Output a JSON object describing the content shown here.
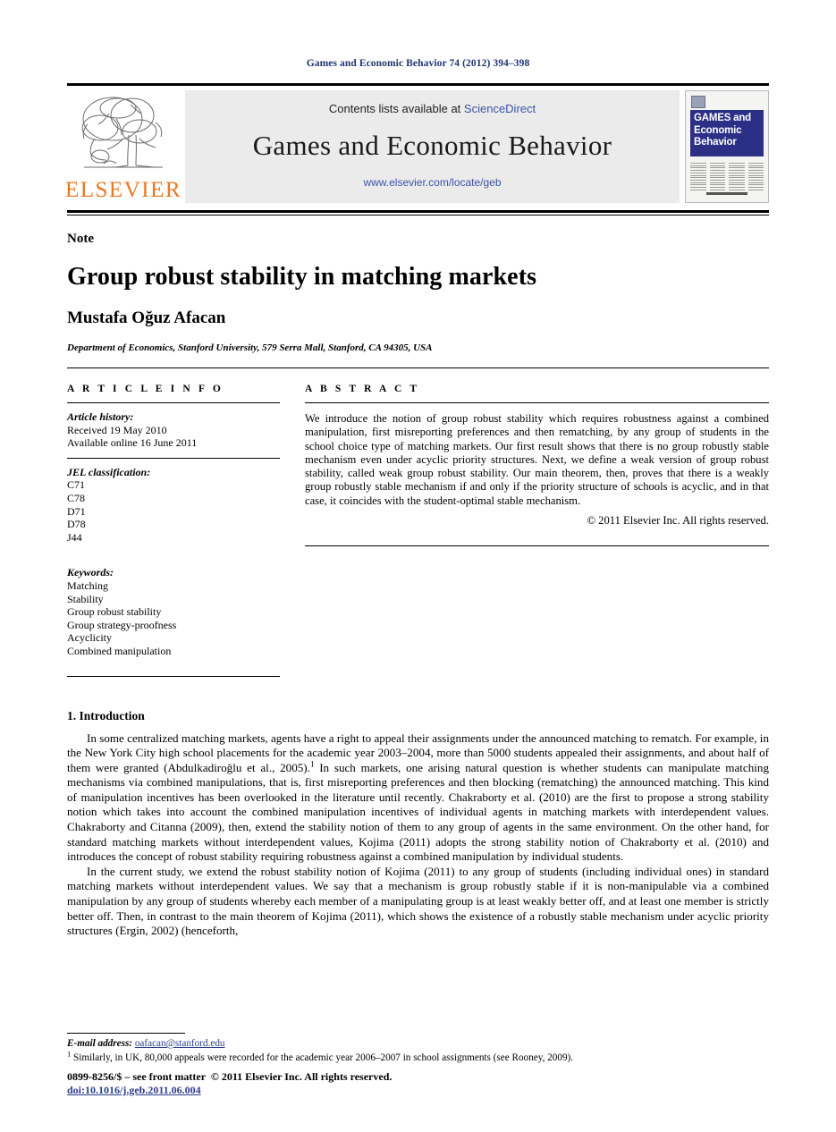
{
  "running_head": "Games and Economic Behavior 74 (2012) 394–398",
  "masthead": {
    "publisher_name": "ELSEVIER",
    "contents_prefix": "Contents lists available at",
    "sciencedirect": "ScienceDirect",
    "journal_name": "Games and Economic Behavior",
    "journal_url": "www.elsevier.com/locate/geb",
    "cover_title_line1": "GAMES and",
    "cover_title_line2": "Economic",
    "cover_title_line3": "Behavior"
  },
  "article": {
    "type_label": "Note",
    "title": "Group robust stability in matching markets",
    "author": "Mustafa Oğuz Afacan",
    "affiliation": "Department of Economics, Stanford University, 579 Serra Mall, Stanford, CA 94305, USA"
  },
  "article_info": {
    "heading": "A R T I C L E   I N F O",
    "history_label": "Article history:",
    "received": "Received 19 May 2010",
    "available_online": "Available online 16 June 2011",
    "jel_label": "JEL classification:",
    "jel_codes": [
      "C71",
      "C78",
      "D71",
      "D78",
      "J44"
    ],
    "keywords_label": "Keywords:",
    "keywords": [
      "Matching",
      "Stability",
      "Group robust stability",
      "Group strategy-proofness",
      "Acyclicity",
      "Combined manipulation"
    ]
  },
  "abstract": {
    "heading": "A B S T R A C T",
    "text": "We introduce the notion of group robust stability which requires robustness against a combined manipulation, first misreporting preferences and then rematching, by any group of students in the school choice type of matching markets. Our first result shows that there is no group robustly stable mechanism even under acyclic priority structures. Next, we define a weak version of group robust stability, called weak group robust stability. Our main theorem, then, proves that there is a weakly group robustly stable mechanism if and only if the priority structure of schools is acyclic, and in that case, it coincides with the student-optimal stable mechanism.",
    "copyright": "© 2011 Elsevier Inc. All rights reserved."
  },
  "body": {
    "section_title": "1. Introduction",
    "paragraph1_a": "In some centralized matching markets, agents have a right to appeal their assignments under the announced matching to rematch. For example, in the New York City high school placements for the academic year 2003–2004, more than 5000 students appealed their assignments, and about half of them were granted (Abdulkadiroğlu et al., 2005).",
    "paragraph1_footnote_marker": "1",
    "paragraph1_b": " In such markets, one arising natural question is whether students can manipulate matching mechanisms via combined manipulations, that is, first misreporting preferences and then blocking (rematching) the announced matching. This kind of manipulation incentives has been overlooked in the literature until recently. Chakraborty et al. (2010) are the first to propose a strong stability notion which takes into account the combined manipulation incentives of individual agents in matching markets with interdependent values. Chakraborty and Citanna (2009), then, extend the stability notion of them to any group of agents in the same environment. On the other hand, for standard matching markets without interdependent values, Kojima (2011) adopts the strong stability notion of Chakraborty et al. (2010) and introduces the concept of robust stability requiring robustness against a combined manipulation by individual students.",
    "paragraph2": "In the current study, we extend the robust stability notion of Kojima (2011) to any group of students (including individual ones) in standard matching markets without interdependent values. We say that a mechanism is group robustly stable if it is non-manipulable via a combined manipulation by any group of students whereby each member of a manipulating group is at least weakly better off, and at least one member is strictly better off. Then, in contrast to the main theorem of Kojima (2011), which shows the existence of a robustly stable mechanism under acyclic priority structures (Ergin, 2002) (henceforth,"
  },
  "footnotes": {
    "email_label": "E-mail address:",
    "email": "oafacan@stanford.edu",
    "note_marker": "1",
    "note_text": "Similarly, in UK, 80,000 appeals were recorded for the academic year 2006–2007 in school assignments (see Rooney, 2009)."
  },
  "footer": {
    "issn_line": "0899-8256/$ – see front matter",
    "copyright": "© 2011 Elsevier Inc. All rights reserved.",
    "doi": "doi:10.1016/j.geb.2011.06.004"
  },
  "colors": {
    "running_head": "#1f3470",
    "link_blue": "#3a53a4",
    "elsevier_orange": "#E87722",
    "cover_blue": "#2b2f86"
  }
}
